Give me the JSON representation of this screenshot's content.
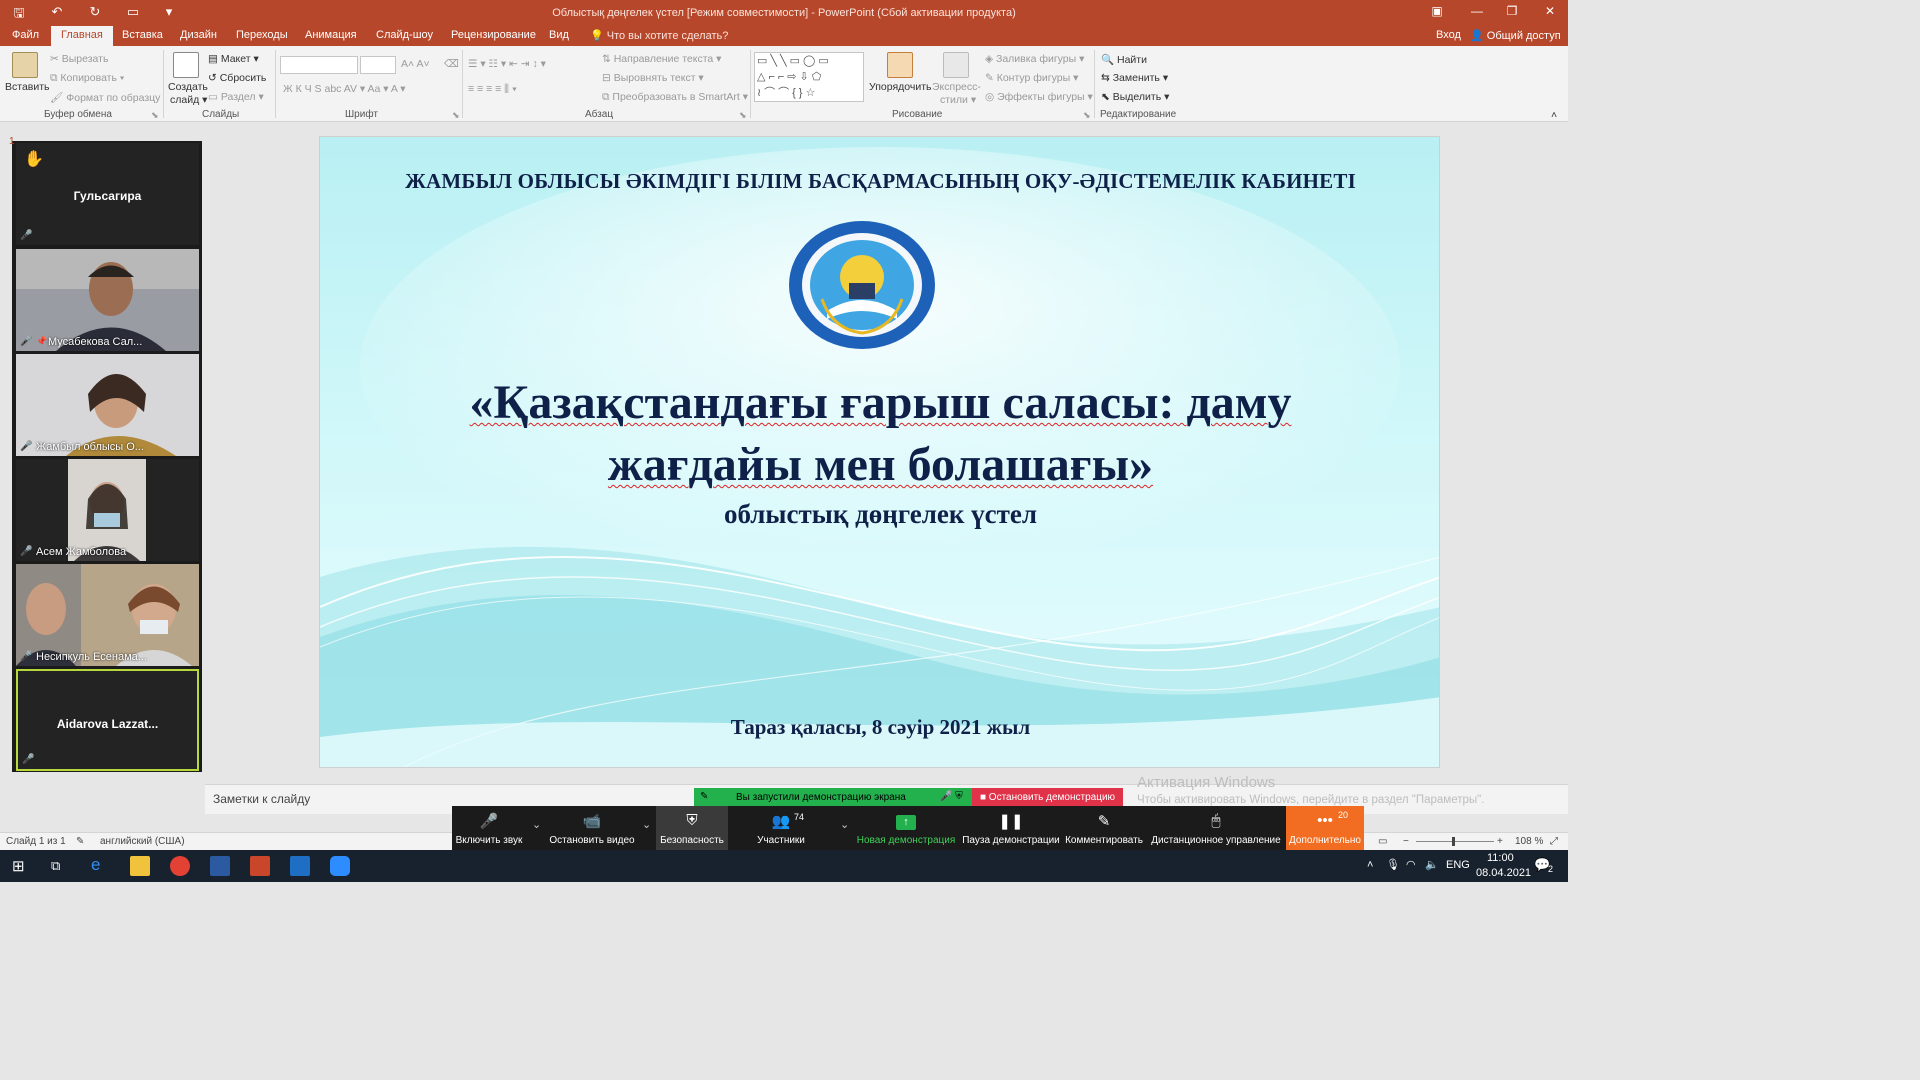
{
  "window": {
    "title": "Облыстық дөңгелек үстел  [Режим совместимости] - PowerPoint (Сбой активации продукта)"
  },
  "menu": {
    "tabs": [
      "Файл",
      "Главная",
      "Вставка",
      "Дизайн",
      "Переходы",
      "Анимация",
      "Слайд-шоу",
      "Рецензирование",
      "Вид"
    ],
    "active": "Главная",
    "tell_me": "Что вы хотите сделать?",
    "sign_in": "Вход",
    "share": "Общий доступ"
  },
  "ribbon": {
    "clipboard": {
      "paste": "Вставить",
      "cut": "Вырезать",
      "copy": "Копировать",
      "format_painter": "Формат по образцу",
      "group": "Буфер обмена"
    },
    "slides": {
      "new_slide_1": "Создать",
      "new_slide_2": "слайд",
      "layout": "Макет",
      "reset": "Сбросить",
      "section": "Раздел",
      "group": "Слайды"
    },
    "font": {
      "group": "Шрифт"
    },
    "paragraph": {
      "text_direction": "Направление текста",
      "align_text": "Выровнять текст",
      "smartart": "Преобразовать в SmartArt",
      "group": "Абзац"
    },
    "drawing": {
      "arrange": "Упорядочить",
      "quick_styles_1": "Экспресс-",
      "quick_styles_2": "стили",
      "fill": "Заливка фигуры",
      "outline": "Контур фигуры",
      "effects": "Эффекты фигуры",
      "group": "Рисование"
    },
    "editing": {
      "find": "Найти",
      "replace": "Заменить",
      "select": "Выделить",
      "group": "Редактирование"
    }
  },
  "participants": [
    {
      "name": "Гульсагира",
      "video": false,
      "hand_raised": true
    },
    {
      "name": "Мусабекова Сал...",
      "video": true
    },
    {
      "name": "Жамбыл облысы О...",
      "video": true
    },
    {
      "name": "Асем Жамболова",
      "video": true
    },
    {
      "name": "Несипкуль Есенама...",
      "video": true
    },
    {
      "name": "Aidarova  Lazzat...",
      "video": false
    }
  ],
  "slide": {
    "header": "ЖАМБЫЛ ОБЛЫСЫ ӘКІМДІГІ БІЛІМ БАСҚАРМАСЫНЫҢ  ОҚУ-ӘДІСТЕМЕЛІК КАБИНЕТІ",
    "title_line1": "«Қазақстандағы ғарыш саласы: даму",
    "title_line2": "жағдайы мен болашағы»",
    "subtitle": "облыстық дөңгелек үстел",
    "footer": "Тараз қаласы, 8 сәуір 2021 жыл"
  },
  "notes_placeholder": "Заметки к слайду",
  "activation": {
    "title": "Активация Windows",
    "text": "Чтобы активировать Windows, перейдите в раздел \"Параметры\"."
  },
  "status": {
    "slide_info": "Слайд 1 из 1",
    "language": "английский (США)",
    "zoom": "108 %"
  },
  "zoom_banner": {
    "sharing": "Вы запустили демонстрацию экрана",
    "stop": "Остановить демонстрацию"
  },
  "zoom_toolbar": {
    "unmute": "Включить звук",
    "stop_video": "Остановить видео",
    "security": "Безопасность",
    "participants": "Участники",
    "participants_count": "74",
    "new_share": "Новая демонстрация",
    "pause_share": "Пауза демонстрации",
    "annotate": "Комментировать",
    "remote_control": "Дистанционное управление",
    "more": "Дополнительно",
    "more_count": "20"
  },
  "taskbar": {
    "lang": "ENG",
    "time": "11:00",
    "date": "08.04.2021",
    "notifications": "2"
  },
  "colors": {
    "powerpoint_accent": "#b7472a",
    "slide_background": "#bff3f6",
    "slide_text": "#0f2049",
    "zoom_toolbar": "#1b1b1b",
    "zoom_green": "#23b14d",
    "zoom_red": "#e0334a",
    "zoom_orange": "#f26d21"
  }
}
